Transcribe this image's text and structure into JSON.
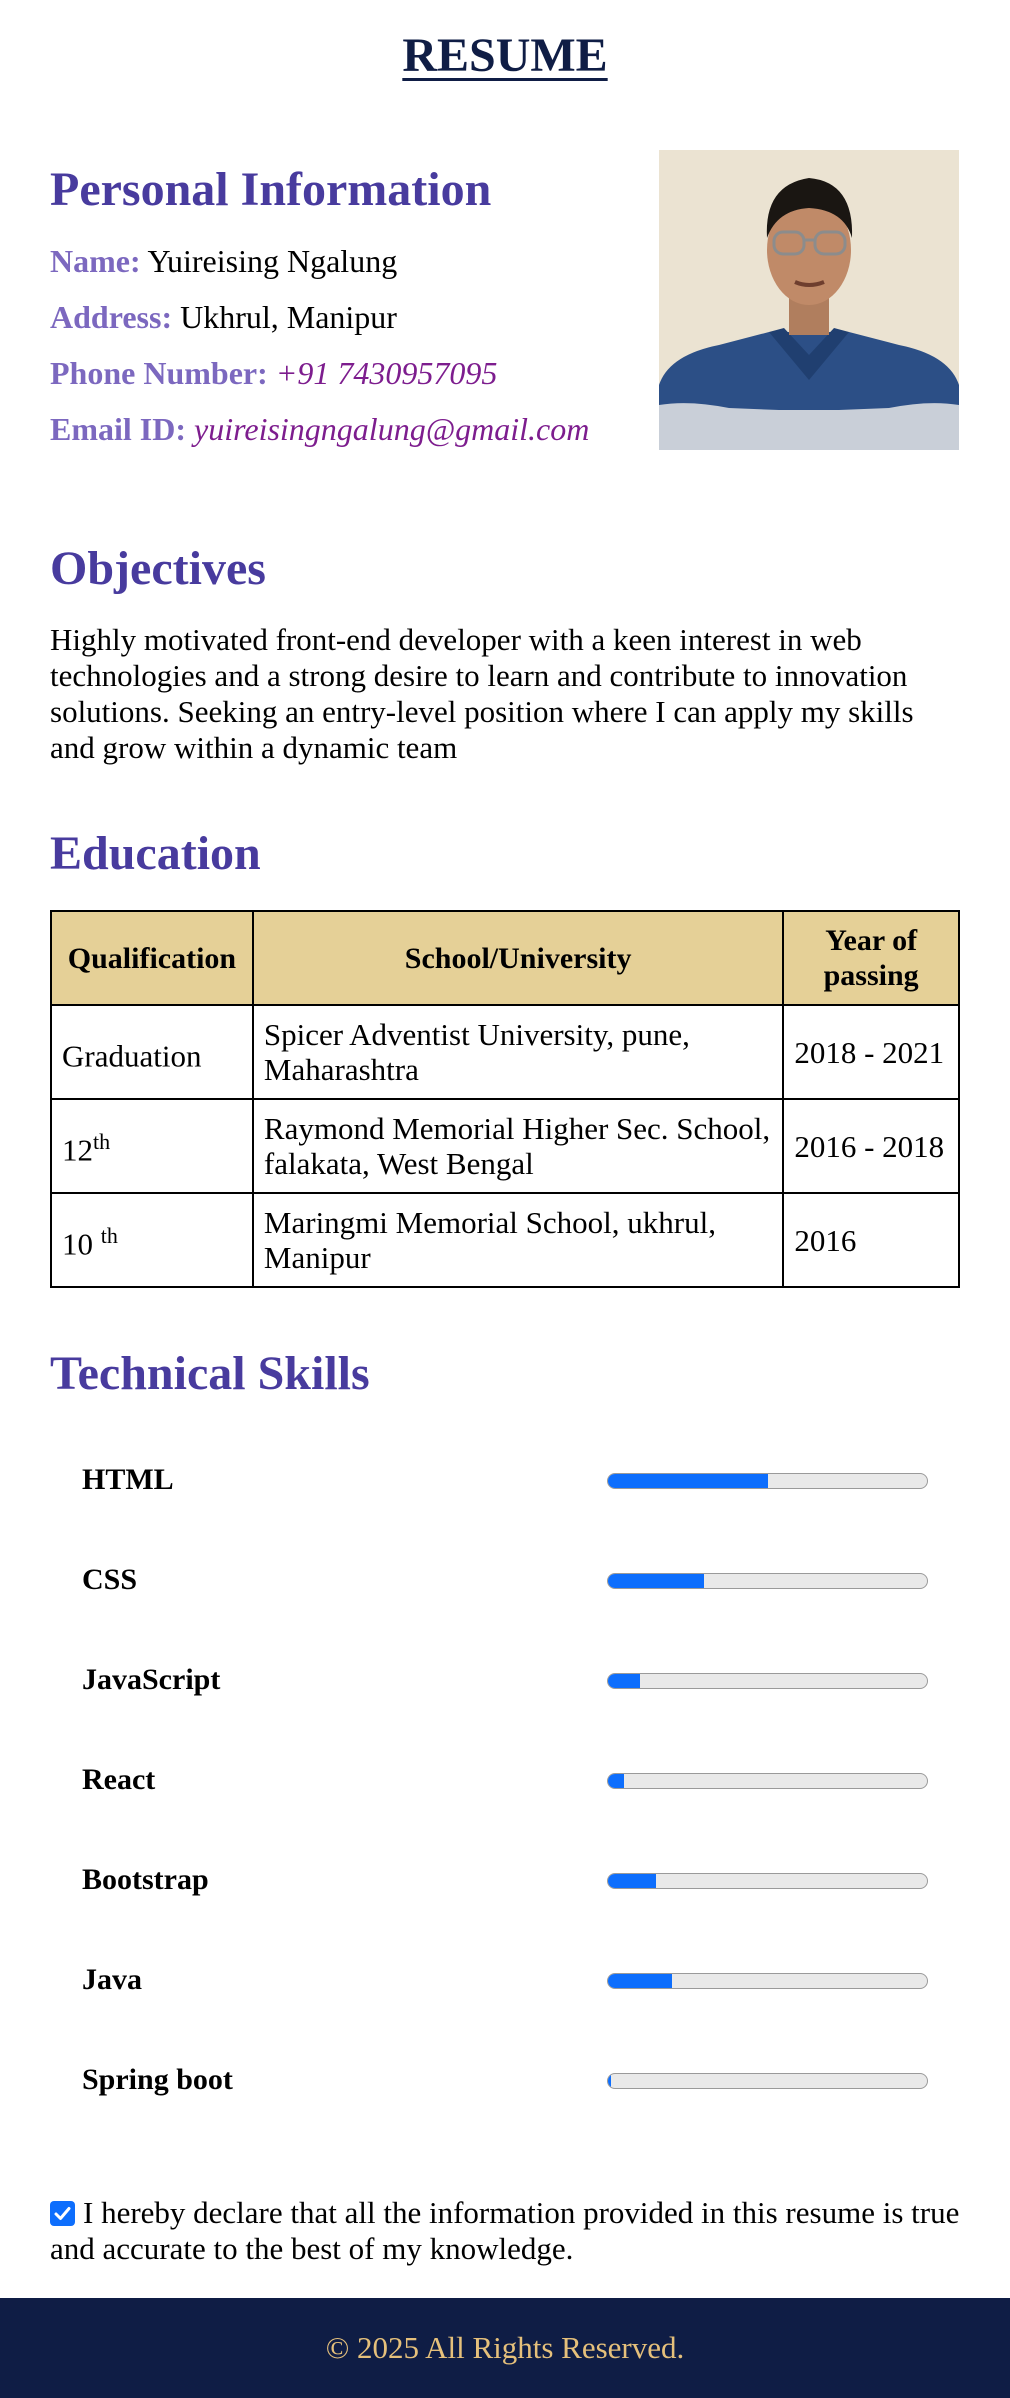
{
  "title": "RESUME",
  "personal": {
    "heading": "Personal Information",
    "name_label": "Name:",
    "name_value": "Yuireising Ngalung",
    "address_label": "Address:",
    "address_value": "Ukhrul, Manipur",
    "phone_label": "Phone Number:",
    "phone_value": "+91 7430957095",
    "email_label": "Email ID:",
    "email_value": "yuireisingngalung@gmail.com"
  },
  "objectives": {
    "heading": "Objectives",
    "text": "Highly motivated front-end developer with a keen interest in web technologies and a strong desire to learn and contribute to innovation solutions. Seeking an entry-level position where I can apply my skills and grow within a dynamic team"
  },
  "education": {
    "heading": "Education",
    "columns": [
      "Qualification",
      "School/University",
      "Year of passing"
    ],
    "rows": [
      {
        "qualification": "Graduation",
        "sup": "",
        "school": "Spicer Adventist University, pune, Maharashtra",
        "year": "2018 - 2021"
      },
      {
        "qualification": "12",
        "sup": "th",
        "school": "Raymond Memorial Higher Sec. School, falakata, West Bengal",
        "year": "2016 - 2018"
      },
      {
        "qualification": "10 ",
        "sup": "th",
        "school": "Maringmi Memorial School, ukhrul, Manipur",
        "year": "2016"
      }
    ]
  },
  "skills": {
    "heading": "Technical Skills",
    "accent_color": "#0d6efd",
    "items": [
      {
        "name": "HTML",
        "level": 0.5
      },
      {
        "name": "CSS",
        "level": 0.3
      },
      {
        "name": "JavaScript",
        "level": 0.1
      },
      {
        "name": "React",
        "level": 0.05
      },
      {
        "name": "Bootstrap",
        "level": 0.15
      },
      {
        "name": "Java",
        "level": 0.2
      },
      {
        "name": "Spring boot",
        "level": 0.01
      }
    ]
  },
  "declaration": {
    "checked": true,
    "text": "I hereby declare that all the information provided in this resume is true and accurate to the best of my knowledge."
  },
  "footer": {
    "text": "© 2025 All Rights Reserved."
  }
}
